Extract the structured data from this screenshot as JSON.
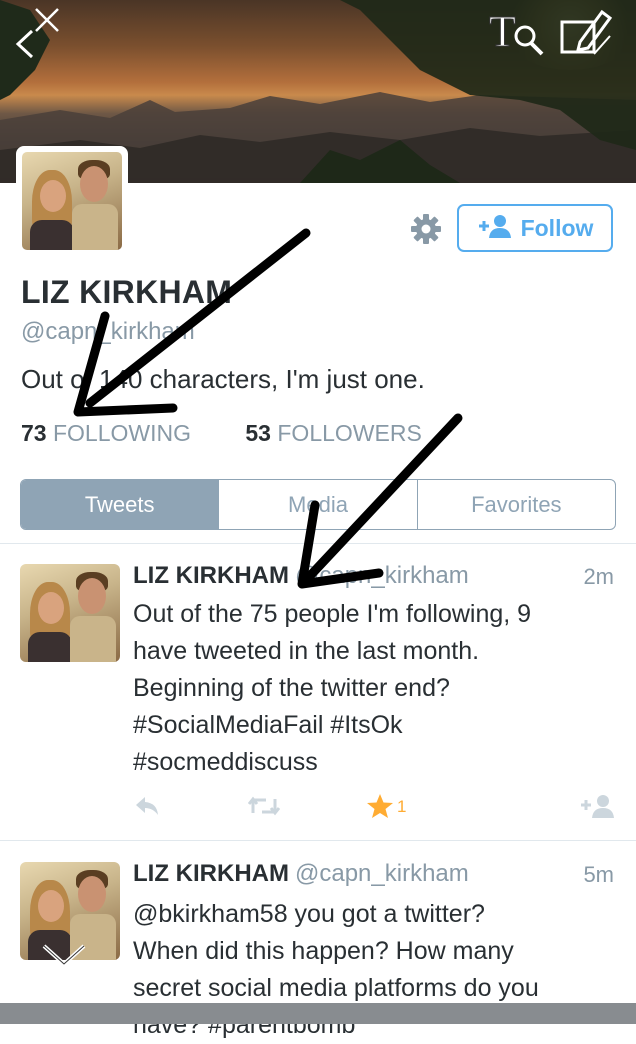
{
  "profile": {
    "name": "LIZ KIRKHAM",
    "handle": "@capn_kirkham",
    "bio": "Out of 140 characters, I'm just one.",
    "following_count": "73",
    "following_label": "FOLLOWING",
    "followers_count": "53",
    "followers_label": "FOLLOWERS",
    "follow_label": "Follow"
  },
  "tabs": [
    {
      "label": "Tweets",
      "active": true
    },
    {
      "label": "Media",
      "active": false
    },
    {
      "label": "Favorites",
      "active": false
    }
  ],
  "tweets": [
    {
      "name": "LIZ KIRKHAM",
      "handle": "@capn_kirkham",
      "time": "2m",
      "lines": [
        "Out of the 75 people I'm following, 9",
        "have tweeted in the last month.",
        "Beginning of the twitter end?",
        "#SocialMediaFail #ItsOk",
        "#socmeddiscuss"
      ],
      "favorite_count": "1"
    },
    {
      "name": "LIZ KIRKHAM",
      "handle": "@capn_kirkham",
      "time": "5m",
      "lines": [
        "@bkirkham58 you got a twitter?",
        "When did this happen? How many",
        "secret social media platforms do you",
        "have? #parentbomb"
      ]
    }
  ],
  "icons": {
    "back": "back-arrow-icon",
    "close": "close-icon",
    "text_tool": "text-magnifier-icon",
    "edit": "edit-pencil-icon",
    "settings": "gear-icon",
    "add_user": "add-user-icon",
    "reply": "reply-icon",
    "retweet": "retweet-icon",
    "favorite": "star-icon",
    "follow_small": "follow-icon",
    "collapse": "chevron-down-icon"
  },
  "colors": {
    "accent": "#55acee",
    "tab_active": "#8fa4b5",
    "favorite": "#ffac33",
    "muted": "#8899a6"
  }
}
